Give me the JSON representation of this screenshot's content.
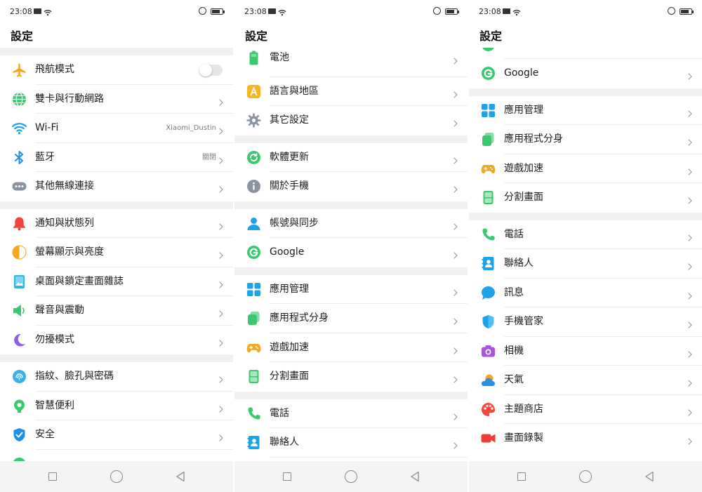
{
  "status_bar": {
    "time": "23:08"
  },
  "app_bar": {
    "title": "設定"
  },
  "colors": {
    "accent": "#1e88e5",
    "page_bg": "#ffffff",
    "section_gap": "#f0f0f0",
    "nav_bar": "#f4f4f4"
  },
  "panels": [
    {
      "sections": [
        {
          "items": [
            {
              "label": "飛航模式",
              "icon": "airplane-icon",
              "control": "toggle",
              "toggle_on": false
            },
            {
              "label": "雙卡與行動網路",
              "icon": "globe-icon"
            },
            {
              "label": "Wi-Fi",
              "icon": "wifi-icon",
              "value": "Xiaomi_Dustin"
            },
            {
              "label": "藍牙",
              "icon": "bluetooth-icon",
              "value": "關閉"
            },
            {
              "label": "其他無線連接",
              "icon": "more-connections-icon"
            }
          ]
        },
        {
          "items": [
            {
              "label": "通知與狀態列",
              "icon": "bell-icon"
            },
            {
              "label": "螢幕顯示與亮度",
              "icon": "brightness-icon"
            },
            {
              "label": "桌面與鎖定畫面雜誌",
              "icon": "wallpaper-icon"
            },
            {
              "label": "聲音與震動",
              "icon": "speaker-icon"
            },
            {
              "label": "勿擾模式",
              "icon": "moon-icon"
            }
          ]
        },
        {
          "items": [
            {
              "label": "指紋、臉孔與密碼",
              "icon": "fingerprint-face-icon"
            },
            {
              "label": "智慧便利",
              "icon": "smart-assist-icon"
            },
            {
              "label": "安全",
              "icon": "shield-check-icon"
            },
            {
              "label": "",
              "icon": "partial-icon",
              "clip": "bottom"
            }
          ]
        }
      ]
    },
    {
      "sections": [
        {
          "items": [
            {
              "label": "電池",
              "icon": "battery-icon",
              "clip": "top-soft"
            },
            {
              "label": "語言與地區",
              "icon": "language-icon"
            },
            {
              "label": "其它設定",
              "icon": "gear-icon"
            }
          ]
        },
        {
          "items": [
            {
              "label": "軟體更新",
              "icon": "update-icon"
            },
            {
              "label": "關於手機",
              "icon": "info-icon"
            }
          ]
        },
        {
          "items": [
            {
              "label": "帳號與同步",
              "icon": "account-icon"
            },
            {
              "label": "Google",
              "icon": "google-icon"
            }
          ]
        },
        {
          "items": [
            {
              "label": "應用管理",
              "icon": "app-grid-icon"
            },
            {
              "label": "應用程式分身",
              "icon": "clone-app-icon"
            },
            {
              "label": "遊戲加速",
              "icon": "gamepad-icon"
            },
            {
              "label": "分割畫面",
              "icon": "split-screen-icon"
            }
          ]
        },
        {
          "items": [
            {
              "label": "電話",
              "icon": "phone-icon"
            },
            {
              "label": "聯絡人",
              "icon": "contacts-icon"
            },
            {
              "label": "",
              "icon": "partial-icon",
              "clip": "bottom"
            }
          ]
        }
      ]
    },
    {
      "sections": [
        {
          "items": [
            {
              "label": "",
              "icon": "partial-icon",
              "clip": "top"
            },
            {
              "label": "Google",
              "icon": "google-icon"
            }
          ]
        },
        {
          "items": [
            {
              "label": "應用管理",
              "icon": "app-grid-icon"
            },
            {
              "label": "應用程式分身",
              "icon": "clone-app-icon"
            },
            {
              "label": "遊戲加速",
              "icon": "gamepad-icon"
            },
            {
              "label": "分割畫面",
              "icon": "split-screen-icon"
            }
          ]
        },
        {
          "items": [
            {
              "label": "電話",
              "icon": "phone-icon"
            },
            {
              "label": "聯絡人",
              "icon": "contacts-icon"
            },
            {
              "label": "訊息",
              "icon": "message-icon"
            },
            {
              "label": "手機管家",
              "icon": "phone-manager-icon"
            },
            {
              "label": "相機",
              "icon": "camera-icon"
            },
            {
              "label": "天氣",
              "icon": "weather-icon"
            },
            {
              "label": "主題商店",
              "icon": "theme-store-icon"
            },
            {
              "label": "畫面錄製",
              "icon": "screen-record-icon"
            }
          ]
        }
      ]
    }
  ]
}
